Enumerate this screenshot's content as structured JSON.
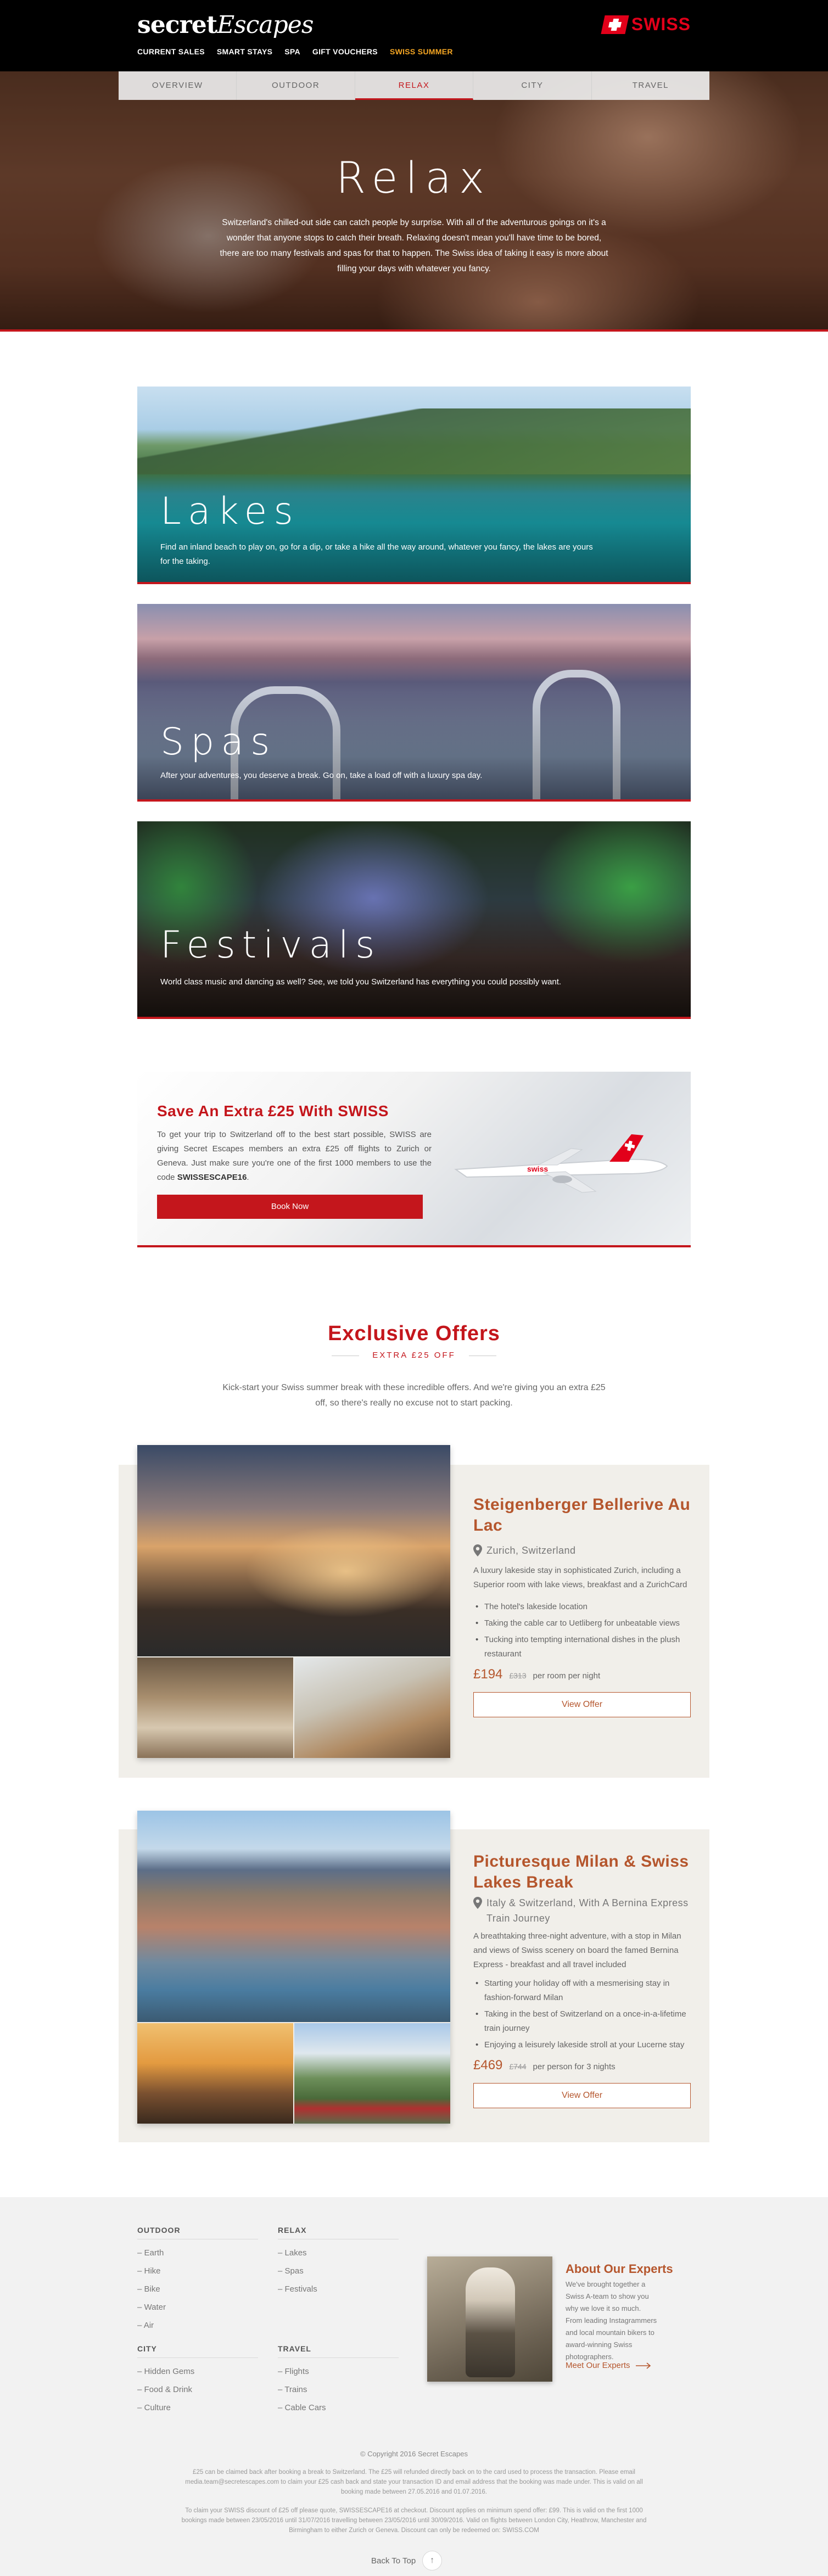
{
  "header": {
    "logo_main": "secret",
    "logo_light": "Escapes",
    "nav": [
      {
        "label": "CURRENT SALES"
      },
      {
        "label": "SMART STAYS"
      },
      {
        "label": "SPA"
      },
      {
        "label": "GIFT VOUCHERS"
      },
      {
        "label": "SWISS SUMMER"
      }
    ],
    "partner_logo": "SWISS",
    "active_color": "#f5a623"
  },
  "subnav": {
    "tabs": [
      {
        "label": "OVERVIEW"
      },
      {
        "label": "OUTDOOR"
      },
      {
        "label": "RELAX"
      },
      {
        "label": "CITY"
      },
      {
        "label": "TRAVEL"
      }
    ],
    "active": "RELAX"
  },
  "hero": {
    "title": "Relax",
    "text": "Switzerland's chilled-out side can catch people by surprise. With all of the adventurous goings on it's a wonder that anyone stops to catch their breath. Relaxing doesn't mean you'll have time to be bored, there are too many festivals and spas for that to happen. The Swiss idea of taking it easy is more about filling your days with whatever you fancy."
  },
  "categories": [
    {
      "title": "Lakes",
      "text": "Find an inland beach to play on, go for a dip, or take a hike all the way around, whatever you fancy, the lakes are yours for the taking."
    },
    {
      "title": "Spas",
      "text": "After your adventures, you deserve a break. Go on, take a load off with a luxury spa day."
    },
    {
      "title": "Festivals",
      "text": "World class music and dancing as well? See, we told you Switzerland has everything you could possibly want."
    }
  ],
  "promo": {
    "title": "Save An Extra £25 With SWISS",
    "text_before": "To get your trip to Switzerland off to the best start possible, SWISS are giving Secret Escapes members an extra £25 off flights to Zurich or Geneva. Just make sure you're one of the first 1000 members to use the code ",
    "code": "SWISSESCAPE16",
    "text_after": ".",
    "button": "Book Now"
  },
  "offers_section": {
    "title": "Exclusive Offers",
    "subtitle": "EXTRA £25 OFF",
    "intro": "Kick-start your Swiss summer break with these incredible offers. And we're giving you an extra £25 off, so there's really no excuse not to start packing."
  },
  "offers": [
    {
      "name": "Steigenberger Bellerive Au Lac",
      "location": "Zurich, Switzerland",
      "description": "A luxury lakeside stay in sophisticated Zurich, including a Superior room with lake views, breakfast and a ZurichCard",
      "bullets": [
        "The hotel's lakeside location",
        "Taking the cable car to Uetliberg for unbeatable views",
        "Tucking into tempting international dishes in the plush restaurant"
      ],
      "price": "£194",
      "was": "£313",
      "note": "per room per night",
      "button": "View Offer"
    },
    {
      "name": "Picturesque Milan & Swiss Lakes Break",
      "location": "Italy & Switzerland, With A Bernina Express Train Journey",
      "description": "A breathtaking three-night adventure, with a stop in Milan and views of Swiss scenery on board the famed Bernina Express - breakfast and all travel included",
      "bullets": [
        "Starting your holiday off with a mesmerising stay in fashion-forward Milan",
        "Taking in the best of Switzerland on a once-in-a-lifetime train journey",
        "Enjoying a leisurely lakeside stroll at your Lucerne stay"
      ],
      "price": "£469",
      "was": "£744",
      "note": "per person for 3 nights",
      "button": "View Offer"
    }
  ],
  "footer": {
    "columns": [
      {
        "heading": "OUTDOOR",
        "links": [
          "Earth",
          "Hike",
          "Bike",
          "Water",
          "Air"
        ]
      },
      {
        "heading": "RELAX",
        "links": [
          "Lakes",
          "Spas",
          "Festivals"
        ]
      },
      {
        "heading": "CITY",
        "links": [
          "Hidden Gems",
          "Food & Drink",
          "Culture"
        ]
      },
      {
        "heading": "TRAVEL",
        "links": [
          "Flights",
          "Trains",
          "Cable Cars"
        ]
      }
    ],
    "experts": {
      "title": "About Our Experts",
      "text": "We've brought together a Swiss A-team to show you why we love it so much. From leading Instagrammers and local mountain bikers to award-winning Swiss photographers.",
      "link": "Meet Our Experts"
    },
    "copyright": "© Copyright 2016 Secret Escapes",
    "legal1": "£25 can be claimed back after booking a break to Switzerland. The £25 will refunded directly back on to the card used to process the transaction. Please email media.team@secretescapes.com to claim your £25 cash back and state your transaction ID and email address that the booking was made under. This is valid on all booking made between 27.05.2016 and 01.07.2016.",
    "legal2": "To claim your SWISS discount of £25 off please quote, SWISSESCAPE16 at checkout. Discount applies on minimum spend offer: £99. This is valid on the first 1000 bookings made between 23/05/2016 until 31/07/2016 travelling between 23/05/2016 until 30/09/2016. Valid on flights between London City, Heathrow, Manchester and Birmingham to either Zurich or Geneva. Discount can only be redeemed on: SWISS.COM",
    "back_to_top": "Back To Top"
  }
}
